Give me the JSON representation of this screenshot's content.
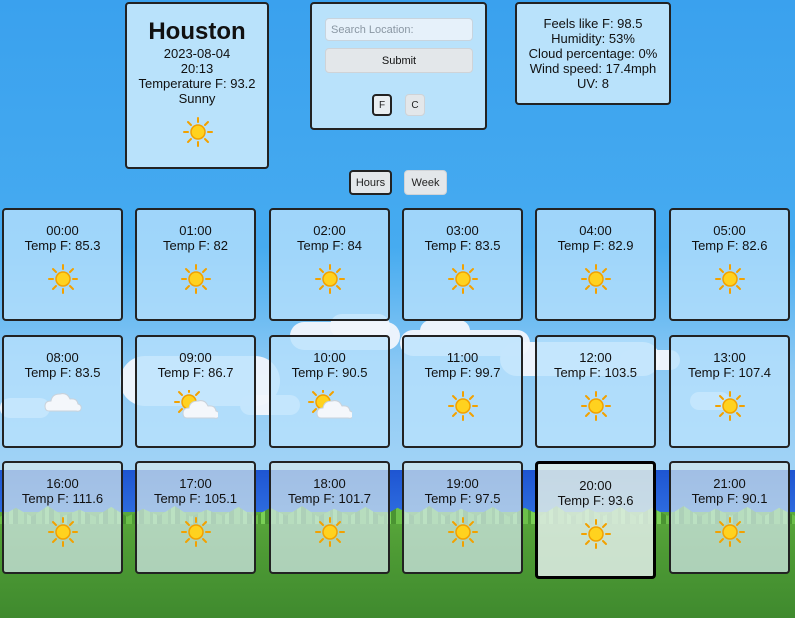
{
  "location": {
    "city": "Houston",
    "date": "2023-08-04",
    "time": "20:13",
    "temperature": "Temperature F: 93.2",
    "condition": "Sunny",
    "condition_icon": "sun-icon"
  },
  "search": {
    "placeholder": "Search Location:",
    "value": "",
    "submit_label": "Submit",
    "unit_f_label": "F",
    "unit_c_label": "C",
    "selected_unit": "F"
  },
  "details": {
    "feels_like": "Feels like F: 98.5",
    "humidity": "Humidity: 53%",
    "cloud": "Cloud percentage: 0%",
    "wind": "Wind speed: 17.4mph",
    "uv": "UV: 8"
  },
  "view_toggle": {
    "hours_label": "Hours",
    "week_label": "Week",
    "selected": "Hours"
  },
  "hours": [
    {
      "time": "00:00",
      "temp": "Temp F: 85.3",
      "icon": "sun-icon"
    },
    {
      "time": "01:00",
      "temp": "Temp F: 82",
      "icon": "sun-icon"
    },
    {
      "time": "02:00",
      "temp": "Temp F: 84",
      "icon": "sun-icon"
    },
    {
      "time": "03:00",
      "temp": "Temp F: 83.5",
      "icon": "sun-icon"
    },
    {
      "time": "04:00",
      "temp": "Temp F: 82.9",
      "icon": "sun-icon"
    },
    {
      "time": "05:00",
      "temp": "Temp F: 82.6",
      "icon": "sun-icon"
    },
    {
      "time": "08:00",
      "temp": "Temp F: 83.5",
      "icon": "cloud-icon"
    },
    {
      "time": "09:00",
      "temp": "Temp F: 86.7",
      "icon": "partly-cloudy-icon"
    },
    {
      "time": "10:00",
      "temp": "Temp F: 90.5",
      "icon": "partly-cloudy-icon"
    },
    {
      "time": "11:00",
      "temp": "Temp F: 99.7",
      "icon": "sun-icon"
    },
    {
      "time": "12:00",
      "temp": "Temp F: 103.5",
      "icon": "sun-icon"
    },
    {
      "time": "13:00",
      "temp": "Temp F: 107.4",
      "icon": "sun-icon"
    },
    {
      "time": "16:00",
      "temp": "Temp F: 111.6",
      "icon": "sun-icon"
    },
    {
      "time": "17:00",
      "temp": "Temp F: 105.1",
      "icon": "sun-icon"
    },
    {
      "time": "18:00",
      "temp": "Temp F: 101.7",
      "icon": "sun-icon"
    },
    {
      "time": "19:00",
      "temp": "Temp F: 97.5",
      "icon": "sun-icon"
    },
    {
      "time": "20:00",
      "temp": "Temp F: 93.6",
      "icon": "sun-icon",
      "selected": true
    },
    {
      "time": "21:00",
      "temp": "Temp F: 90.1",
      "icon": "sun-icon"
    }
  ]
}
